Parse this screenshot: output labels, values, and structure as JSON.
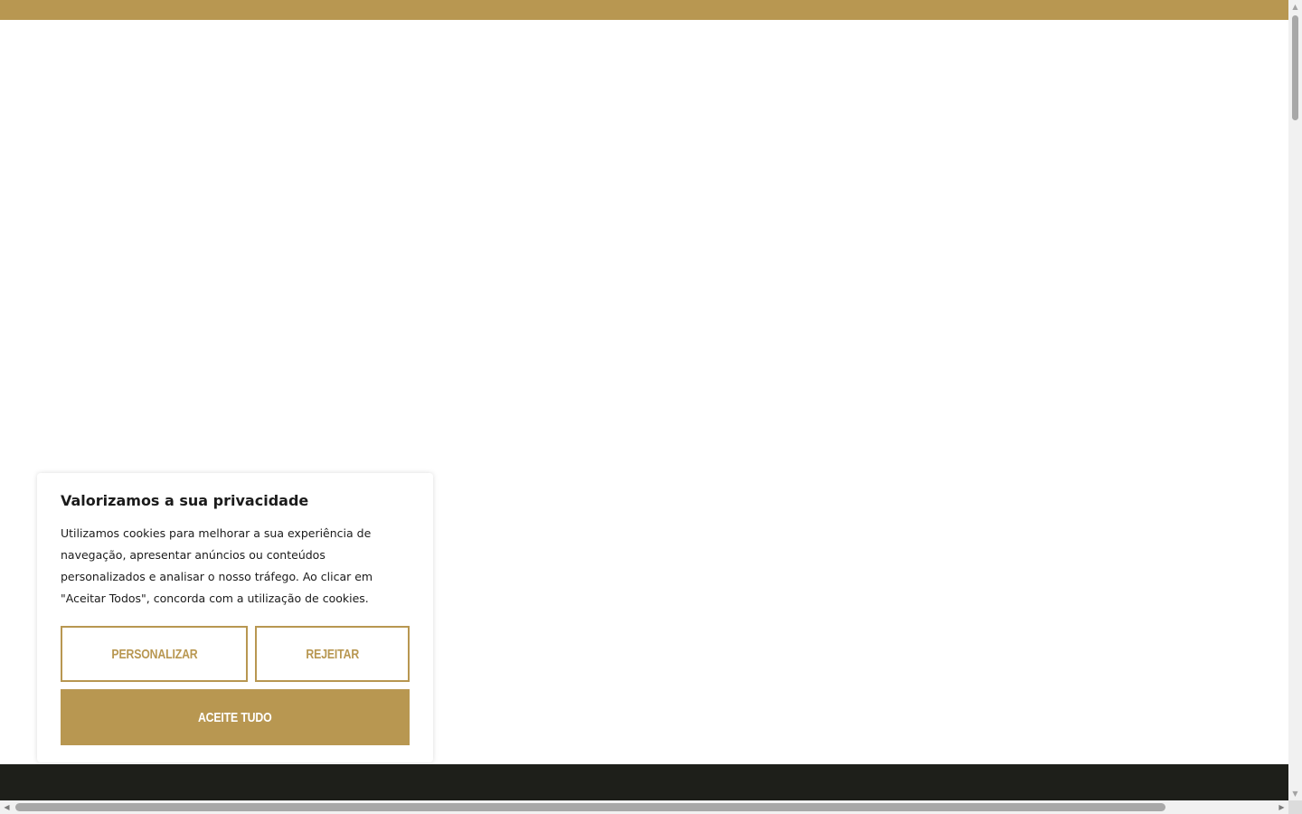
{
  "colors": {
    "brand_gold": "#b89751",
    "footer_dark": "#1e1f1a",
    "text_dark": "#1b1b1b"
  },
  "cookie_banner": {
    "title": "Valorizamos a sua privacidade",
    "message": "Utilizamos cookies para melhorar a sua experiência de navegação, apresentar anúncios ou conteúdos personalizados e analisar o nosso tráfego. Ao clicar em \"Aceitar Todos\", concorda com a utilização de cookies.",
    "customize_label": "PERSONALIZAR",
    "reject_label": "REJEITAR",
    "accept_all_label": "ACEITE TUDO"
  },
  "scrollbars": {
    "up_icon": "arrow-up-icon",
    "down_icon": "arrow-down-icon",
    "left_icon": "arrow-left-icon",
    "right_icon": "arrow-right-icon"
  }
}
